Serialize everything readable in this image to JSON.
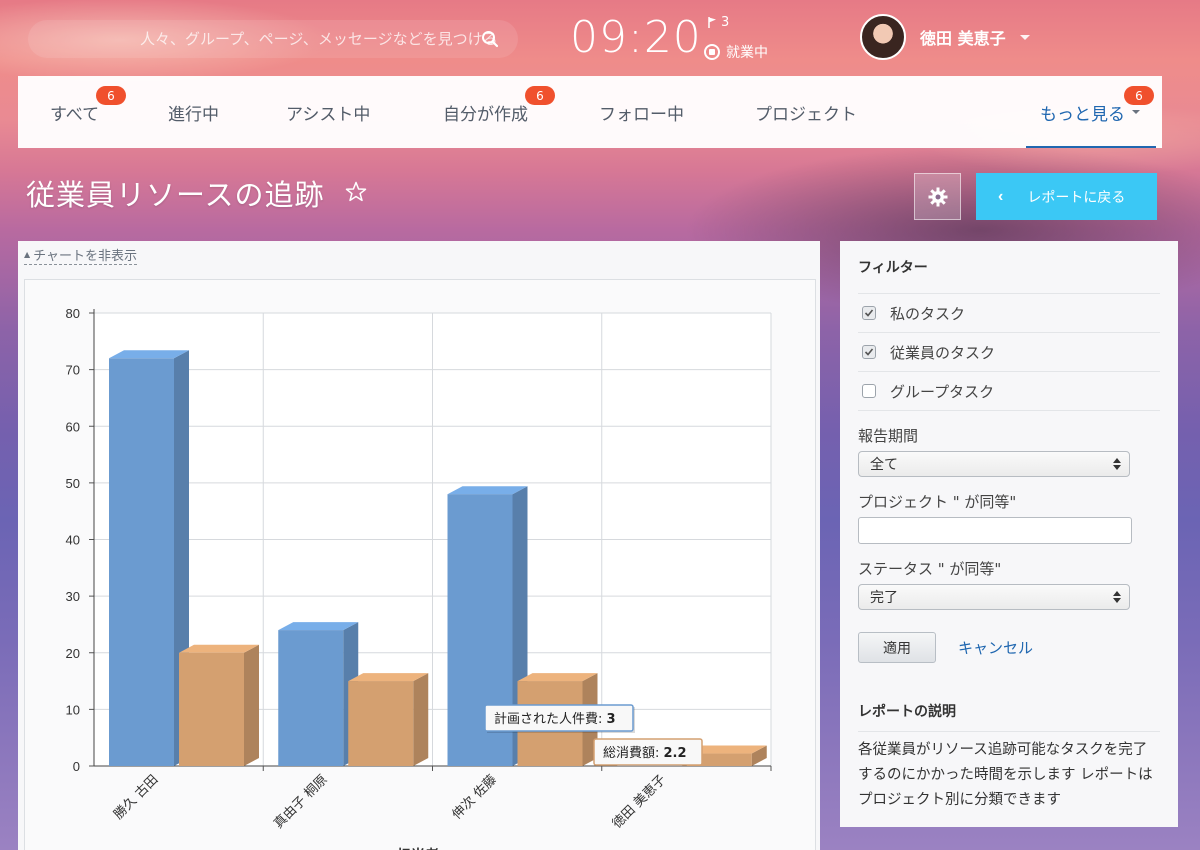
{
  "header": {
    "search_placeholder": "人々、グループ、ページ、メッセージなどを見つける",
    "time": "09:20",
    "flag_count": "3",
    "work_status": "就業中",
    "user_name": "徳田 美恵子"
  },
  "tabs": [
    {
      "label": "すべて",
      "badge": "6"
    },
    {
      "label": "進行中",
      "badge": ""
    },
    {
      "label": "アシスト中",
      "badge": ""
    },
    {
      "label": "自分が作成",
      "badge": "6"
    },
    {
      "label": "フォロー中",
      "badge": ""
    },
    {
      "label": "プロジェクト",
      "badge": ""
    },
    {
      "label": "もっと見る",
      "badge": "6",
      "active": true
    }
  ],
  "page": {
    "title": "従業員リソースの追跡",
    "back_button": "レポートに戻る"
  },
  "chart_toggle": "チャートを非表示",
  "chart_data": {
    "type": "bar",
    "categories": [
      "勝久 古田",
      "真由子 桐原",
      "伸次 佐藤",
      "徳田 美恵子"
    ],
    "series": [
      {
        "name": "計画された人件費",
        "values": [
          72,
          24,
          48,
          0
        ],
        "color": "#6b9bd0"
      },
      {
        "name": "総消費額",
        "values": [
          20,
          15,
          15,
          2.2
        ],
        "color": "#d4a070"
      }
    ],
    "ylim": [
      0,
      80
    ],
    "yticks": [
      0,
      10,
      20,
      30,
      40,
      50,
      60,
      70,
      80
    ],
    "xlabel": "担当者",
    "grid": true,
    "tooltips": [
      {
        "label": "計画された人件費",
        "value": "3"
      },
      {
        "label": "総消費額",
        "value": "2.2"
      }
    ]
  },
  "filters": {
    "title": "フィルター",
    "checkboxes": [
      {
        "label": "私のタスク",
        "checked": true
      },
      {
        "label": "従業員のタスク",
        "checked": true
      },
      {
        "label": "グループタスク",
        "checked": false
      }
    ],
    "period_label": "報告期間",
    "period_value": "全て",
    "project_label": "プロジェクト \" が同等\"",
    "project_value": "",
    "status_label": "ステータス \" が同等\"",
    "status_value": "完了",
    "apply": "適用",
    "cancel": "キャンセル"
  },
  "description": {
    "title": "レポートの説明",
    "text": "各従業員がリソース追跡可能なタスクを完了するのにかかった時間を示します レポートはプロジェクト別に分類できます"
  }
}
